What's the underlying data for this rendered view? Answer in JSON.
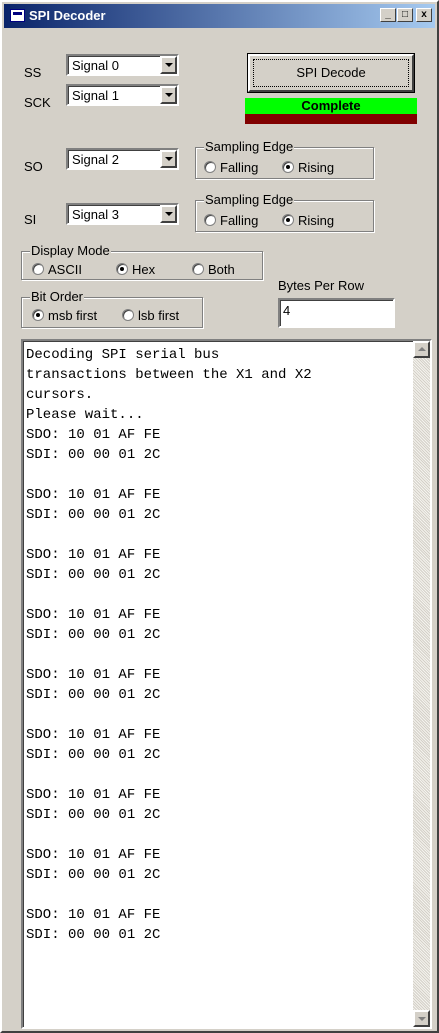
{
  "window": {
    "title": "SPI Decoder",
    "minimize": "_",
    "maximize": "□",
    "close": "x"
  },
  "labels": {
    "ss": "SS",
    "sck": "SCK",
    "so": "SO",
    "si": "SI"
  },
  "combos": {
    "ss": "Signal 0",
    "sck": "Signal 1",
    "so": "Signal 2",
    "si": "Signal 3"
  },
  "decode_button": "SPI Decode",
  "status": {
    "text": "Complete",
    "color": "#00ff00"
  },
  "so_edge": {
    "title": "Sampling Edge",
    "falling": "Falling",
    "rising": "Rising",
    "selected": "Rising"
  },
  "si_edge": {
    "title": "Sampling Edge",
    "falling": "Falling",
    "rising": "Rising",
    "selected": "Rising"
  },
  "display_mode": {
    "title": "Display Mode",
    "ascii": "ASCII",
    "hex": "Hex",
    "both": "Both",
    "selected": "Hex"
  },
  "bit_order": {
    "title": "Bit Order",
    "msb": "msb first",
    "lsb": "lsb first",
    "selected": "msb first"
  },
  "bytes_per_row": {
    "label": "Bytes Per Row",
    "value": "4"
  },
  "output": {
    "text": "Decoding SPI serial bus\ntransactions between the X1 and X2\ncursors.\nPlease wait...\nSDO: 10 01 AF FE\nSDI: 00 00 01 2C\n\nSDO: 10 01 AF FE\nSDI: 00 00 01 2C\n\nSDO: 10 01 AF FE\nSDI: 00 00 01 2C\n\nSDO: 10 01 AF FE\nSDI: 00 00 01 2C\n\nSDO: 10 01 AF FE\nSDI: 00 00 01 2C\n\nSDO: 10 01 AF FE\nSDI: 00 00 01 2C\n\nSDO: 10 01 AF FE\nSDI: 00 00 01 2C\n\nSDO: 10 01 AF FE\nSDI: 00 00 01 2C\n\nSDO: 10 01 AF FE\nSDI: 00 00 01 2C"
  },
  "theme": {
    "titlebar": "#0a246a",
    "face": "#d4d0c8",
    "status_bar2": "#800000"
  }
}
